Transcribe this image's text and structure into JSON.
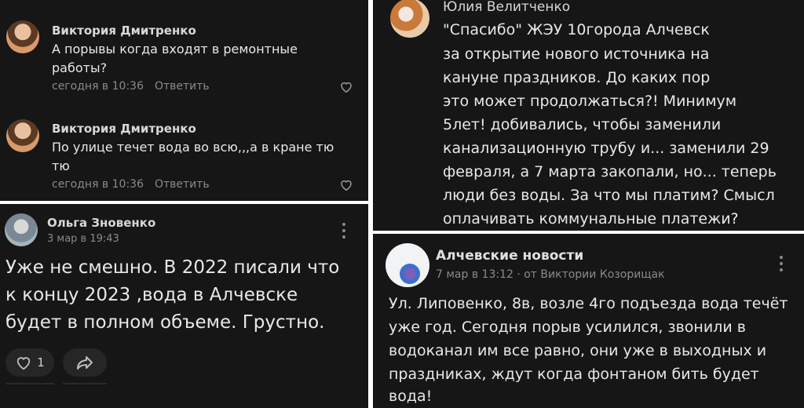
{
  "panel_tl": {
    "comments": [
      {
        "author": "Виктория Дмитренко",
        "lines": [
          "А порывы когда входят в ремонтные",
          "работы?"
        ],
        "time": "сегодня в 10:36",
        "reply": "Ответить",
        "like_icon": "heart-outline-icon"
      },
      {
        "author": "Виктория Дмитренко",
        "lines": [
          "По улице течет вода во всю,,,а в кране тю",
          "тю"
        ],
        "time": "сегодня в 10:36",
        "reply": "Ответить",
        "like_icon": "heart-outline-icon"
      }
    ]
  },
  "panel_bl": {
    "author": "Ольга Зновенко",
    "date": "3 мар в 19:43",
    "lines": [
      "Уже не смешно. В 2022 писали что",
      "к концу 2023 ,вода в Алчевске",
      "будет  в полном объеме. Грустно."
    ],
    "likes": "1",
    "like_icon": "heart-outline-icon",
    "share_icon": "share-arrow-icon",
    "menu_icon": "more-vertical-icon"
  },
  "panel_tr": {
    "author": "Юлия Велитченко",
    "lines": [
      "\"Спасибо\" ЖЭУ 10города Алчевск",
      "за открытие нового источника на",
      "кануне праздников. До каких пор",
      "это может продолжаться?! Минимум",
      "5лет! добивались, чтобы заменили",
      "канализационную трубу и... заменили 29",
      "февраля, а 7 марта закопали, но... теперь",
      "люди без воды. За что мы платим? Смысл",
      "оплачивать коммунальные платежи?"
    ]
  },
  "panel_br": {
    "author": "Алчевские новости",
    "date": "7 мар в 13:12",
    "source": "· от Виктории Козорищак",
    "lines": [
      "Ул. Липовенко, 8в, возле 4го подъезда вода течёт",
      "уже год. Сегодня порыв усилился, звонили в",
      "водоканал им все равно, они уже в выходных и",
      "праздниках, ждут когда фонтаном бить будет",
      "вода!"
    ],
    "menu_icon": "more-vertical-icon"
  },
  "colors": {
    "bg": "#161616",
    "divider": "#ffffff",
    "text": "#e8e8e8",
    "muted": "#8a8a8a"
  }
}
